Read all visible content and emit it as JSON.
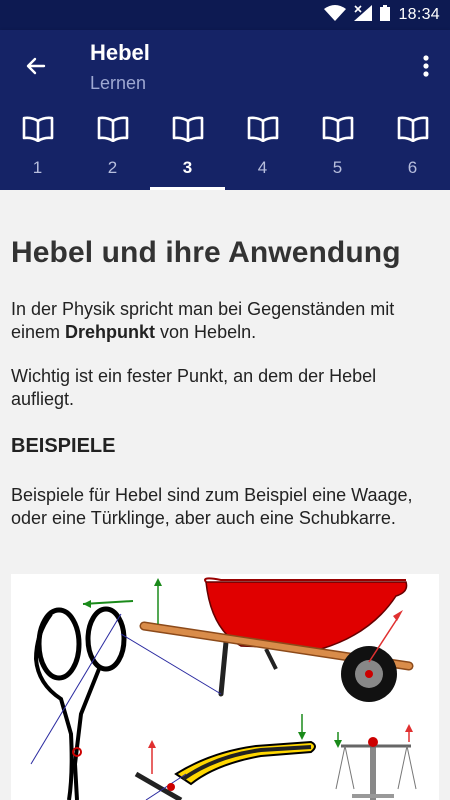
{
  "status_bar": {
    "time": "18:34",
    "icons": [
      "wifi-icon",
      "signal-icon",
      "battery-icon"
    ]
  },
  "app_bar": {
    "title": "Hebel",
    "subtitle": "Lernen",
    "back_icon": "arrow-back-icon",
    "menu_icon": "more-vert-icon"
  },
  "tabs": [
    {
      "label": "1",
      "icon": "book-icon"
    },
    {
      "label": "2",
      "icon": "book-icon"
    },
    {
      "label": "3",
      "icon": "book-icon",
      "active": true
    },
    {
      "label": "4",
      "icon": "book-icon"
    },
    {
      "label": "5",
      "icon": "book-icon"
    },
    {
      "label": "6",
      "icon": "book-icon"
    }
  ],
  "content": {
    "heading": "Hebel und ihre Anwendung",
    "p1_before": "In der Physik spricht man bei Gegenständen mit einem ",
    "p1_bold": "Drehpunkt",
    "p1_after": " von Hebeln.",
    "p2": "Wichtig ist ein fester Punkt, an dem der Hebel aufliegt.",
    "section_heading": "BEISPIELE",
    "p3": "Beispiele für Hebel sind zum Beispiel eine Waage, oder eine Türklinge, aber auch eine Schubkarre."
  },
  "colors": {
    "status_bar": "#0d1a52",
    "app_bar": "#152366",
    "background": "#f2f2f2",
    "subtitle": "#9ea8d2",
    "wheelbarrow": "#e00000",
    "handle": "#d98c4a",
    "force_arrow_green": "#1a8a1a",
    "force_arrow_red": "#e03030"
  }
}
